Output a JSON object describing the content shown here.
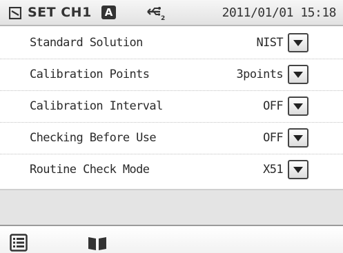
{
  "status_bar": {
    "mode_icon": "mode-icon",
    "mode_label": "SET CH1",
    "auto_badge": "A",
    "usb_icon": "usb-icon",
    "datetime": "2011/01/01 15:18"
  },
  "settings": [
    {
      "label": "Standard Solution",
      "value": "NIST"
    },
    {
      "label": "Calibration Points",
      "value": "3points"
    },
    {
      "label": "Calibration Interval",
      "value": "OFF"
    },
    {
      "label": "Checking Before Use",
      "value": "OFF"
    },
    {
      "label": "Routine Check Mode",
      "value": "X51"
    }
  ],
  "bottom_bar": {
    "left_icon": "menu-list-icon",
    "right_icon": "book-icon"
  }
}
